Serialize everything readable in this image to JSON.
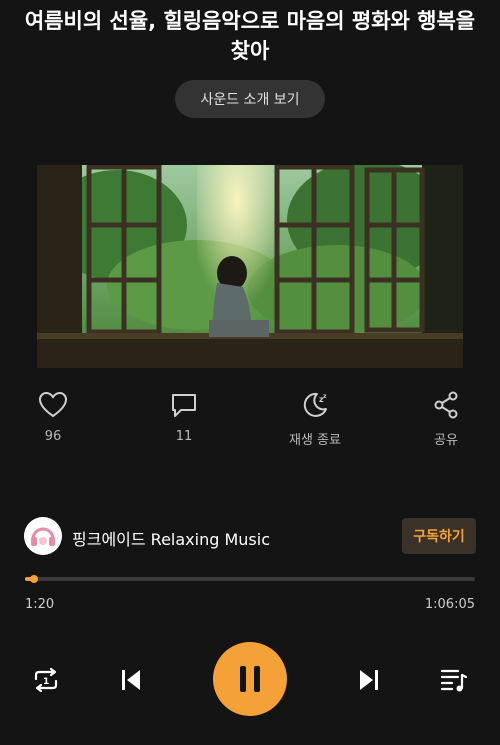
{
  "header": {
    "title": "여름비의 선율, 힐링음악으로 마음의 평화와 행복을 찾아",
    "intro_button": "사운드 소개 보기"
  },
  "artwork": {
    "description_icon": "rainy-window-illustration"
  },
  "actions": [
    {
      "icon": "heart-icon",
      "label": "96"
    },
    {
      "icon": "comment-icon",
      "label": "11"
    },
    {
      "icon": "sleep-timer-icon",
      "label": "재생 종료"
    },
    {
      "icon": "share-icon",
      "label": "공유"
    }
  ],
  "channel": {
    "name": "핑크에이드 Relaxing Music",
    "subscribe_label": "구독하기"
  },
  "player": {
    "current_time": "1:20",
    "total_time": "1:06:05",
    "progress_fraction": 0.02
  },
  "colors": {
    "accent": "#f5a13a",
    "background": "#141414"
  }
}
